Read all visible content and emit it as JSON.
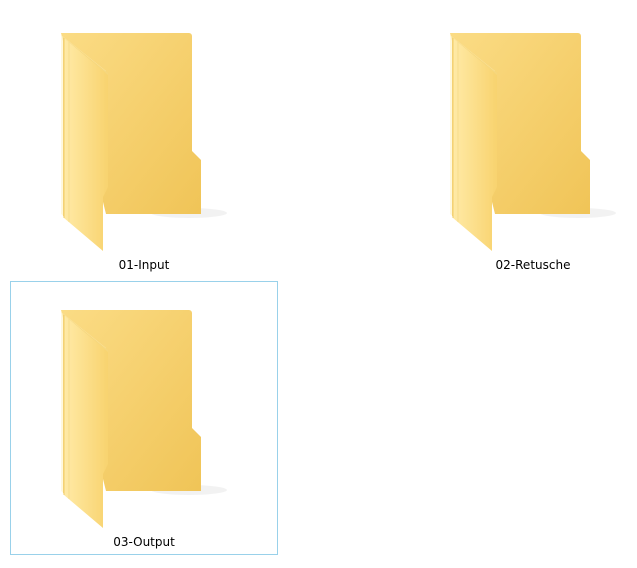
{
  "explorer": {
    "view_mode": "extra-large-icons",
    "items": [
      {
        "name": "01-Input",
        "icon": "folder-icon",
        "focused": false
      },
      {
        "name": "02-Retusche",
        "icon": "folder-icon",
        "focused": false
      },
      {
        "name": "03-Output",
        "icon": "folder-icon",
        "focused": true
      }
    ]
  },
  "colors": {
    "folder_back": "#f2c75a",
    "folder_front_light": "#ffe79c",
    "folder_front_dark": "#f6cf6a",
    "focus_border": "#99d1ea",
    "label_text": "#000000"
  }
}
